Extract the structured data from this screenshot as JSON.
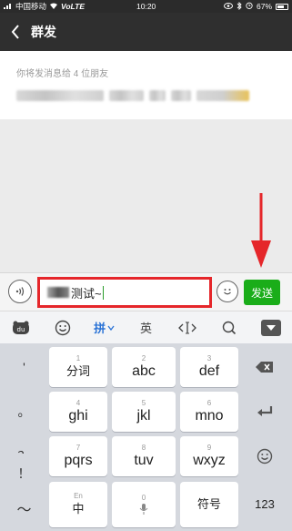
{
  "status_bar": {
    "carrier": "中国移动",
    "network": "VoLTE",
    "time": "10:20",
    "battery": "67%"
  },
  "header": {
    "title": "群发"
  },
  "recipients": {
    "summary": "你将发消息给 4 位朋友"
  },
  "input_bar": {
    "message_text": "测试~",
    "send_label": "发送"
  },
  "keyboard_toolbar": {
    "pinyin_label": "拼",
    "english_label": "英"
  },
  "keyboard": {
    "punct_col": [
      "'",
      "。",
      "？",
      "！"
    ],
    "rows": [
      [
        {
          "num": "1",
          "main": "分词"
        },
        {
          "num": "2",
          "main": "abc"
        },
        {
          "num": "3",
          "main": "def"
        }
      ],
      [
        {
          "num": "4",
          "main": "ghi"
        },
        {
          "num": "5",
          "main": "jkl"
        },
        {
          "num": "6",
          "main": "mno"
        }
      ],
      [
        {
          "num": "7",
          "main": "pqrs"
        },
        {
          "num": "8",
          "main": "tuv"
        },
        {
          "num": "9",
          "main": "wxyz"
        }
      ]
    ],
    "bottom": {
      "tilde": "～",
      "zh_small": "En",
      "zh_main": "中",
      "space_num": "0",
      "symbol": "符号",
      "num_key": "123"
    }
  },
  "colors": {
    "send_green": "#1aad19",
    "highlight_red": "#e5262a",
    "active_blue": "#2b73d6"
  }
}
